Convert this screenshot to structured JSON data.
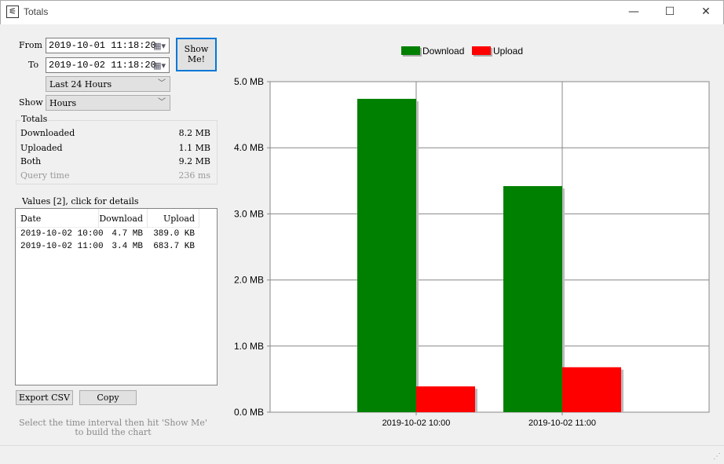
{
  "window": {
    "title": "Totals"
  },
  "form": {
    "from_label": "From",
    "from_value": "2019-10-01 11:18:20",
    "to_label": "To",
    "to_value": "2019-10-02 11:18:20",
    "range_value": "Last 24 Hours",
    "show_label": "Show",
    "show_value": "Hours",
    "show_me_label": "Show Me!"
  },
  "totals": {
    "title": "Totals",
    "rows": [
      {
        "label": "Downloaded",
        "value": "8.2 MB"
      },
      {
        "label": "Uploaded",
        "value": "1.1 MB"
      },
      {
        "label": "Both",
        "value": "9.2 MB"
      },
      {
        "label": "Query time",
        "value": "236 ms"
      }
    ]
  },
  "values": {
    "title": "Values [2], click for details",
    "columns": [
      "Date",
      "Download",
      "Upload"
    ],
    "rows": [
      [
        "2019-10-02 10:00",
        "4.7 MB",
        "389.0 KB"
      ],
      [
        "2019-10-02 11:00",
        "3.4 MB",
        "683.7 KB"
      ]
    ]
  },
  "buttons": {
    "export": "Export CSV",
    "copy": "Copy"
  },
  "hint": "Select the time interval then hit 'Show Me' to build the chart",
  "chart_data": {
    "type": "bar",
    "categories": [
      "2019-10-02 10:00",
      "2019-10-02 11:00"
    ],
    "series": [
      {
        "name": "Download",
        "color": "#008000",
        "values": [
          4.74,
          3.42
        ]
      },
      {
        "name": "Upload",
        "color": "#ff0000",
        "values": [
          0.39,
          0.68
        ]
      }
    ],
    "ylim": [
      0,
      5
    ],
    "yticks": [
      "0.0 MB",
      "1.0 MB",
      "2.0 MB",
      "3.0 MB",
      "4.0 MB",
      "5.0 MB"
    ],
    "unit": "MB",
    "grid": true,
    "legend": "top"
  }
}
